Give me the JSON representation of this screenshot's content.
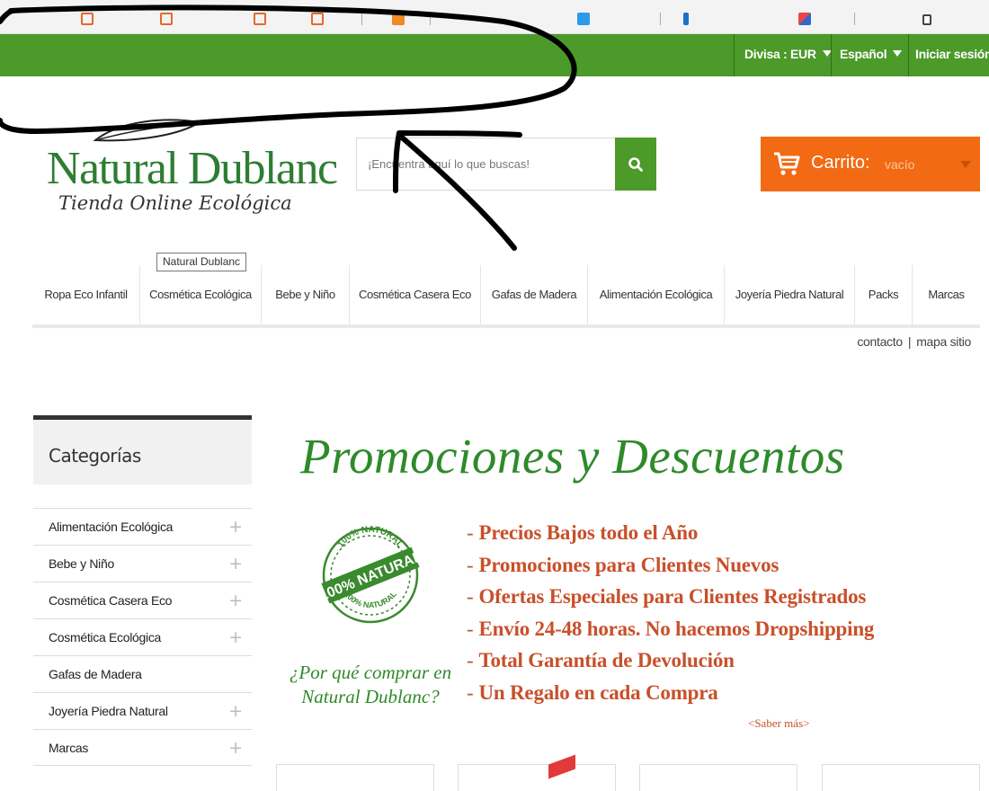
{
  "topbar": {
    "currency_label": "Divisa : EUR",
    "language_label": "Español",
    "login_label": "Iniciar sesión"
  },
  "logo": {
    "name": "Natural Dublanc",
    "tagline": "Tienda Online Ecológica"
  },
  "search": {
    "placeholder": "¡Encuentra aquí lo que buscas!"
  },
  "cart": {
    "label": "Carrito:",
    "status": "vacío"
  },
  "tooltip": "Natural Dublanc",
  "nav": {
    "items": [
      {
        "label": "Ropa Eco Infantil"
      },
      {
        "label": "Cosmética Ecológica"
      },
      {
        "label": "Bebe y Niño"
      },
      {
        "label": "Cosmética Casera Eco"
      },
      {
        "label": "Gafas de Madera"
      },
      {
        "label": "Alimentación Ecológica"
      },
      {
        "label": "Joyería Piedra Natural"
      },
      {
        "label": "Packs"
      },
      {
        "label": "Marcas"
      }
    ]
  },
  "links": {
    "contact": "contacto",
    "sitemap": "mapa sitio"
  },
  "sidebar": {
    "title": "Categorías",
    "items": [
      {
        "label": "Alimentación Ecológica",
        "expandable": true
      },
      {
        "label": "Bebe y Niño",
        "expandable": true
      },
      {
        "label": "Cosmética Casera Eco",
        "expandable": true
      },
      {
        "label": "Cosmética Ecológica",
        "expandable": true
      },
      {
        "label": "Gafas de Madera",
        "expandable": false
      },
      {
        "label": "Joyería Piedra Natural",
        "expandable": true
      },
      {
        "label": "Marcas",
        "expandable": true
      }
    ]
  },
  "promo": {
    "title": "Promociones y Descuentos",
    "seal_top": "100% NATURAL",
    "seal_center": "100% NATURAL",
    "seal_bottom": "100% NATURAL",
    "why_line1": "¿Por qué comprar en",
    "why_line2": "Natural Dublanc?",
    "benefits": [
      "Precios Bajos todo el Año",
      "Promociones para Clientes Nuevos",
      "Ofertas Especiales para Clientes Registrados",
      "Envío 24-48 horas. No hacemos Dropshipping",
      "Total Garantía de Devolución",
      "Un Regalo en cada Compra"
    ],
    "more_link": "<Saber más>"
  },
  "colors": {
    "brand_green": "#4c9a2a",
    "cart_orange": "#f26a13",
    "promo_text": "#c8502a",
    "promo_green": "#2f8a2a"
  }
}
